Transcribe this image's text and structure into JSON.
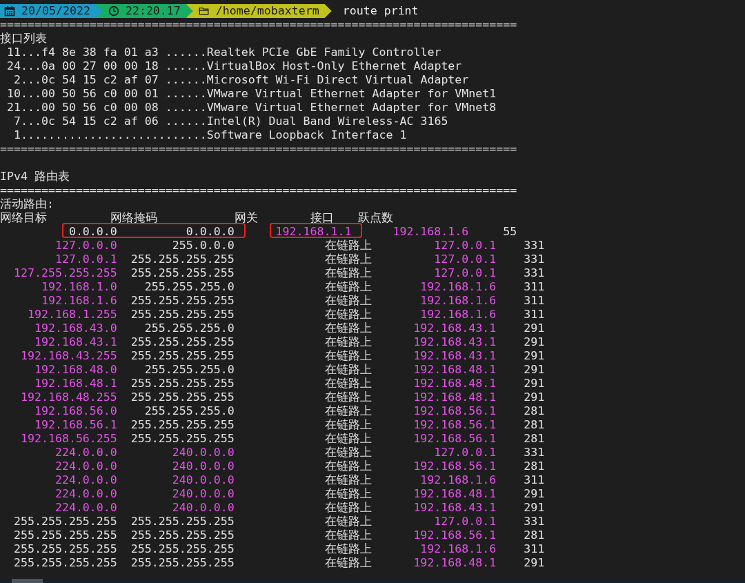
{
  "prompt": {
    "date": "20/05/2022",
    "time": "22:20.17",
    "path": "/home/mobaxterm",
    "command": "route print"
  },
  "separator": "===========================================================================",
  "interface_list": {
    "title": "接口列表",
    "lines": [
      " 11...f4 8e 38 fa 01 a3 ......Realtek PCIe GbE Family Controller",
      " 24...0a 00 27 00 00 18 ......VirtualBox Host-Only Ethernet Adapter",
      "  2...0c 54 15 c2 af 07 ......Microsoft Wi-Fi Direct Virtual Adapter",
      " 10...00 50 56 c0 00 01 ......VMware Virtual Ethernet Adapter for VMnet1",
      " 21...00 50 56 c0 00 08 ......VMware Virtual Ethernet Adapter for VMnet8",
      "  7...0c 54 15 c2 af 06 ......Intel(R) Dual Band Wireless-AC 3165",
      "  1...........................Software Loopback Interface 1"
    ],
    "separator": "==========================================================================="
  },
  "route_table": {
    "title": "IPv4 路由表",
    "separator": "===========================================================================",
    "subtitle": "活动路由:",
    "columns": [
      "网络目标",
      "网络掩码",
      "网关",
      "接口",
      "跃点数"
    ],
    "rows": [
      {
        "kind": "default",
        "annotated": true,
        "cells": [
          {
            "text": "0.0.0.0",
            "highlighted": false
          },
          {
            "text": "0.0.0.0",
            "highlighted": false
          },
          {
            "text": "192.168.1.1",
            "highlighted": true
          },
          {
            "text": "192.168.1.6",
            "highlighted": true
          },
          {
            "text": "55",
            "highlighted": false
          }
        ]
      },
      {
        "kind": "route",
        "annotated": false,
        "cells": [
          {
            "text": "127.0.0.0",
            "highlighted": true
          },
          {
            "text": "255.0.0.0",
            "highlighted": false
          },
          {
            "text": "在链路上",
            "highlighted": false
          },
          {
            "text": "127.0.0.1",
            "highlighted": true
          },
          {
            "text": "331",
            "highlighted": false
          }
        ]
      },
      {
        "kind": "route",
        "annotated": false,
        "cells": [
          {
            "text": "127.0.0.1",
            "highlighted": true
          },
          {
            "text": "255.255.255.255",
            "highlighted": false
          },
          {
            "text": "在链路上",
            "highlighted": false
          },
          {
            "text": "127.0.0.1",
            "highlighted": true
          },
          {
            "text": "331",
            "highlighted": false
          }
        ]
      },
      {
        "kind": "route",
        "annotated": false,
        "cells": [
          {
            "text": "127.255.255.255",
            "highlighted": true
          },
          {
            "text": "255.255.255.255",
            "highlighted": false
          },
          {
            "text": "在链路上",
            "highlighted": false
          },
          {
            "text": "127.0.0.1",
            "highlighted": true
          },
          {
            "text": "331",
            "highlighted": false
          }
        ]
      },
      {
        "kind": "route",
        "annotated": false,
        "cells": [
          {
            "text": "192.168.1.0",
            "highlighted": true
          },
          {
            "text": "255.255.255.0",
            "highlighted": false
          },
          {
            "text": "在链路上",
            "highlighted": false
          },
          {
            "text": "192.168.1.6",
            "highlighted": true
          },
          {
            "text": "311",
            "highlighted": false
          }
        ]
      },
      {
        "kind": "route",
        "annotated": false,
        "cells": [
          {
            "text": "192.168.1.6",
            "highlighted": true
          },
          {
            "text": "255.255.255.255",
            "highlighted": false
          },
          {
            "text": "在链路上",
            "highlighted": false
          },
          {
            "text": "192.168.1.6",
            "highlighted": true
          },
          {
            "text": "311",
            "highlighted": false
          }
        ]
      },
      {
        "kind": "route",
        "annotated": false,
        "cells": [
          {
            "text": "192.168.1.255",
            "highlighted": true
          },
          {
            "text": "255.255.255.255",
            "highlighted": false
          },
          {
            "text": "在链路上",
            "highlighted": false
          },
          {
            "text": "192.168.1.6",
            "highlighted": true
          },
          {
            "text": "311",
            "highlighted": false
          }
        ]
      },
      {
        "kind": "route",
        "annotated": false,
        "cells": [
          {
            "text": "192.168.43.0",
            "highlighted": true
          },
          {
            "text": "255.255.255.0",
            "highlighted": false
          },
          {
            "text": "在链路上",
            "highlighted": false
          },
          {
            "text": "192.168.43.1",
            "highlighted": true
          },
          {
            "text": "291",
            "highlighted": false
          }
        ]
      },
      {
        "kind": "route",
        "annotated": false,
        "cells": [
          {
            "text": "192.168.43.1",
            "highlighted": true
          },
          {
            "text": "255.255.255.255",
            "highlighted": false
          },
          {
            "text": "在链路上",
            "highlighted": false
          },
          {
            "text": "192.168.43.1",
            "highlighted": true
          },
          {
            "text": "291",
            "highlighted": false
          }
        ]
      },
      {
        "kind": "route",
        "annotated": false,
        "cells": [
          {
            "text": "192.168.43.255",
            "highlighted": true
          },
          {
            "text": "255.255.255.255",
            "highlighted": false
          },
          {
            "text": "在链路上",
            "highlighted": false
          },
          {
            "text": "192.168.43.1",
            "highlighted": true
          },
          {
            "text": "291",
            "highlighted": false
          }
        ]
      },
      {
        "kind": "route",
        "annotated": false,
        "cells": [
          {
            "text": "192.168.48.0",
            "highlighted": true
          },
          {
            "text": "255.255.255.0",
            "highlighted": false
          },
          {
            "text": "在链路上",
            "highlighted": false
          },
          {
            "text": "192.168.48.1",
            "highlighted": true
          },
          {
            "text": "291",
            "highlighted": false
          }
        ]
      },
      {
        "kind": "route",
        "annotated": false,
        "cells": [
          {
            "text": "192.168.48.1",
            "highlighted": true
          },
          {
            "text": "255.255.255.255",
            "highlighted": false
          },
          {
            "text": "在链路上",
            "highlighted": false
          },
          {
            "text": "192.168.48.1",
            "highlighted": true
          },
          {
            "text": "291",
            "highlighted": false
          }
        ]
      },
      {
        "kind": "route",
        "annotated": false,
        "cells": [
          {
            "text": "192.168.48.255",
            "highlighted": true
          },
          {
            "text": "255.255.255.255",
            "highlighted": false
          },
          {
            "text": "在链路上",
            "highlighted": false
          },
          {
            "text": "192.168.48.1",
            "highlighted": true
          },
          {
            "text": "291",
            "highlighted": false
          }
        ]
      },
      {
        "kind": "route",
        "annotated": false,
        "cells": [
          {
            "text": "192.168.56.0",
            "highlighted": true
          },
          {
            "text": "255.255.255.0",
            "highlighted": false
          },
          {
            "text": "在链路上",
            "highlighted": false
          },
          {
            "text": "192.168.56.1",
            "highlighted": true
          },
          {
            "text": "281",
            "highlighted": false
          }
        ]
      },
      {
        "kind": "route",
        "annotated": false,
        "cells": [
          {
            "text": "192.168.56.1",
            "highlighted": true
          },
          {
            "text": "255.255.255.255",
            "highlighted": false
          },
          {
            "text": "在链路上",
            "highlighted": false
          },
          {
            "text": "192.168.56.1",
            "highlighted": true
          },
          {
            "text": "281",
            "highlighted": false
          }
        ]
      },
      {
        "kind": "route",
        "annotated": false,
        "cells": [
          {
            "text": "192.168.56.255",
            "highlighted": true
          },
          {
            "text": "255.255.255.255",
            "highlighted": false
          },
          {
            "text": "在链路上",
            "highlighted": false
          },
          {
            "text": "192.168.56.1",
            "highlighted": true
          },
          {
            "text": "281",
            "highlighted": false
          }
        ]
      },
      {
        "kind": "route",
        "annotated": false,
        "cells": [
          {
            "text": "224.0.0.0",
            "highlighted": true
          },
          {
            "text": "240.0.0.0",
            "highlighted": true
          },
          {
            "text": "在链路上",
            "highlighted": false
          },
          {
            "text": "127.0.0.1",
            "highlighted": true
          },
          {
            "text": "331",
            "highlighted": false
          }
        ]
      },
      {
        "kind": "route",
        "annotated": false,
        "cells": [
          {
            "text": "224.0.0.0",
            "highlighted": true
          },
          {
            "text": "240.0.0.0",
            "highlighted": true
          },
          {
            "text": "在链路上",
            "highlighted": false
          },
          {
            "text": "192.168.56.1",
            "highlighted": true
          },
          {
            "text": "281",
            "highlighted": false
          }
        ]
      },
      {
        "kind": "route",
        "annotated": false,
        "cells": [
          {
            "text": "224.0.0.0",
            "highlighted": true
          },
          {
            "text": "240.0.0.0",
            "highlighted": true
          },
          {
            "text": "在链路上",
            "highlighted": false
          },
          {
            "text": "192.168.1.6",
            "highlighted": true
          },
          {
            "text": "311",
            "highlighted": false
          }
        ]
      },
      {
        "kind": "route",
        "annotated": false,
        "cells": [
          {
            "text": "224.0.0.0",
            "highlighted": true
          },
          {
            "text": "240.0.0.0",
            "highlighted": true
          },
          {
            "text": "在链路上",
            "highlighted": false
          },
          {
            "text": "192.168.48.1",
            "highlighted": true
          },
          {
            "text": "291",
            "highlighted": false
          }
        ]
      },
      {
        "kind": "route",
        "annotated": false,
        "cells": [
          {
            "text": "224.0.0.0",
            "highlighted": true
          },
          {
            "text": "240.0.0.0",
            "highlighted": true
          },
          {
            "text": "在链路上",
            "highlighted": false
          },
          {
            "text": "192.168.43.1",
            "highlighted": true
          },
          {
            "text": "291",
            "highlighted": false
          }
        ]
      },
      {
        "kind": "route",
        "annotated": false,
        "cells": [
          {
            "text": "255.255.255.255",
            "highlighted": false
          },
          {
            "text": "255.255.255.255",
            "highlighted": false
          },
          {
            "text": "在链路上",
            "highlighted": false
          },
          {
            "text": "127.0.0.1",
            "highlighted": true
          },
          {
            "text": "331",
            "highlighted": false
          }
        ]
      },
      {
        "kind": "route",
        "annotated": false,
        "cells": [
          {
            "text": "255.255.255.255",
            "highlighted": false
          },
          {
            "text": "255.255.255.255",
            "highlighted": false
          },
          {
            "text": "在链路上",
            "highlighted": false
          },
          {
            "text": "192.168.56.1",
            "highlighted": true
          },
          {
            "text": "281",
            "highlighted": false
          }
        ]
      },
      {
        "kind": "route",
        "annotated": false,
        "cells": [
          {
            "text": "255.255.255.255",
            "highlighted": false
          },
          {
            "text": "255.255.255.255",
            "highlighted": false
          },
          {
            "text": "在链路上",
            "highlighted": false
          },
          {
            "text": "192.168.1.6",
            "highlighted": true
          },
          {
            "text": "311",
            "highlighted": false
          }
        ]
      },
      {
        "kind": "route",
        "annotated": false,
        "cells": [
          {
            "text": "255.255.255.255",
            "highlighted": false
          },
          {
            "text": "255.255.255.255",
            "highlighted": false
          },
          {
            "text": "在链路上",
            "highlighted": false
          },
          {
            "text": "192.168.48.1",
            "highlighted": true
          },
          {
            "text": "291",
            "highlighted": false
          }
        ]
      }
    ]
  }
}
